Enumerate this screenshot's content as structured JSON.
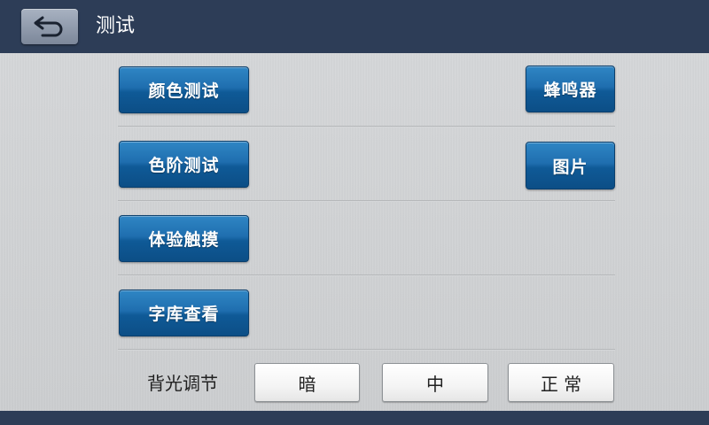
{
  "header": {
    "title": "测试",
    "back_icon": "return-arrow-icon"
  },
  "main": {
    "buttons": {
      "color_test": "颜色测试",
      "gray_scale_test": "色阶测试",
      "touch_test": "体验触摸",
      "font_view": "字库查看",
      "buzzer": "蜂鸣器",
      "picture": "图片"
    },
    "backlight": {
      "label": "背光调节",
      "options": [
        "暗",
        "中",
        "正 常"
      ]
    }
  },
  "colors": {
    "header_bg": "#2d3d57",
    "button_blue": "#1f6eaf",
    "content_bg": "#d0d2d4"
  }
}
